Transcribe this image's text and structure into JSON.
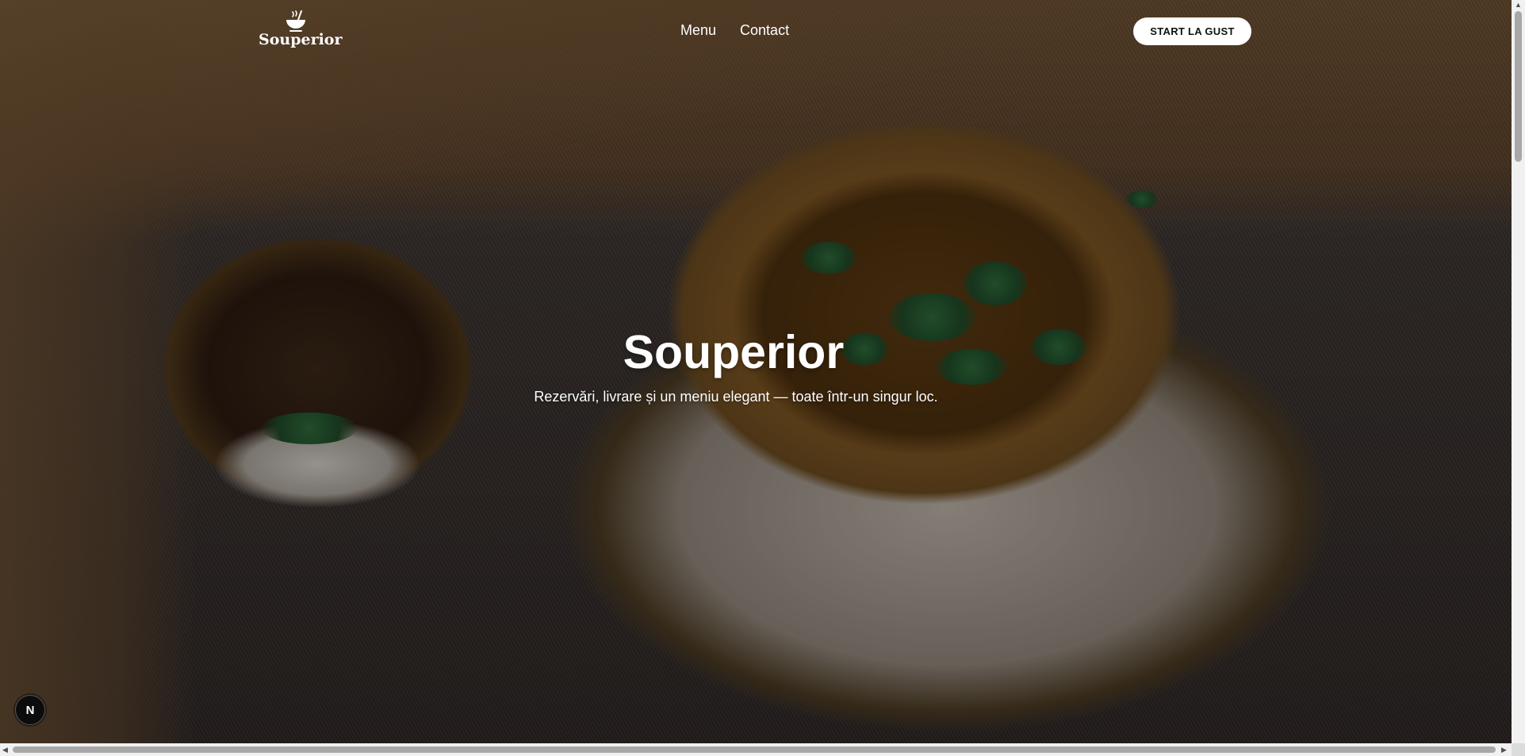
{
  "nav": {
    "logo_text": "Souperior",
    "logo_icon": "soup-bowl-icon",
    "links": [
      "Menu",
      "Contact"
    ],
    "cta_label": "START LA GUST"
  },
  "hero": {
    "title": "Souperior",
    "subtitle": "Rezervări, livrare și un meniu elegant — toate într-un singur loc."
  },
  "dev_badge": {
    "label": "N"
  },
  "colors": {
    "nav_text": "#ffffff",
    "cta_background": "#ffffff",
    "cta_text": "#111111"
  }
}
